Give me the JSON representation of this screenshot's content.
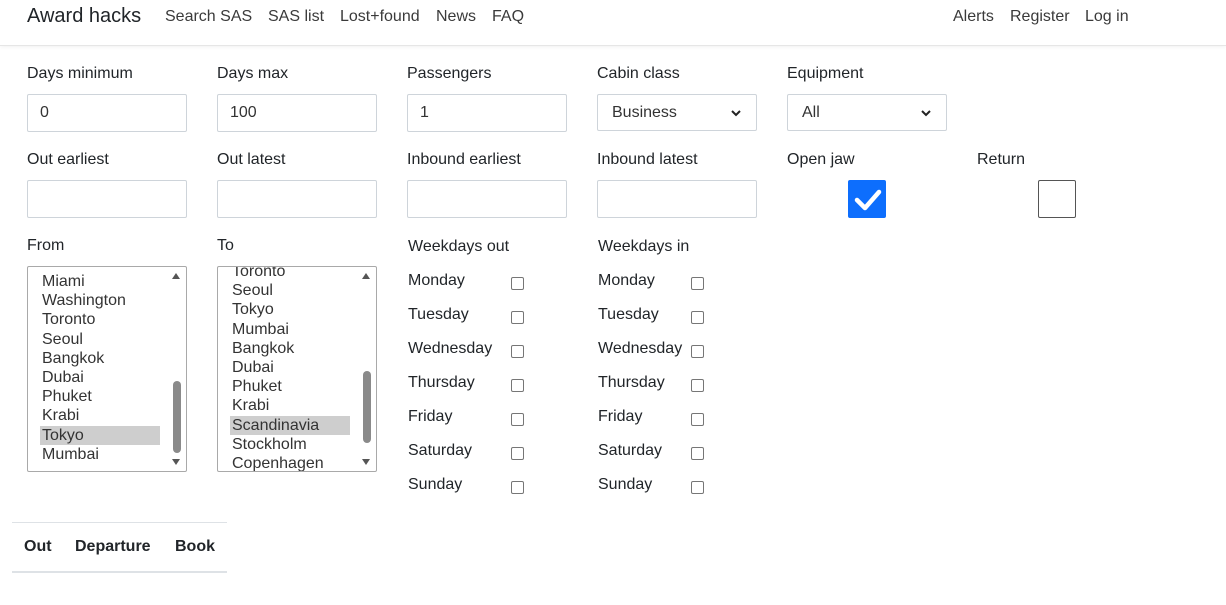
{
  "nav": {
    "brand": "Award hacks",
    "links": [
      "Search SAS",
      "SAS list",
      "Lost+found",
      "News",
      "FAQ"
    ],
    "right_links": [
      "Alerts",
      "Register",
      "Log in"
    ]
  },
  "form": {
    "days_min": {
      "label": "Days minimum",
      "value": "0"
    },
    "days_max": {
      "label": "Days max",
      "value": "100"
    },
    "passengers": {
      "label": "Passengers",
      "value": "1"
    },
    "cabin_class": {
      "label": "Cabin class",
      "selected": "Business"
    },
    "equipment": {
      "label": "Equipment",
      "selected": "All"
    },
    "out_earliest": {
      "label": "Out earliest",
      "value": ""
    },
    "out_latest": {
      "label": "Out latest",
      "value": ""
    },
    "inbound_earliest": {
      "label": "Inbound earliest",
      "value": ""
    },
    "inbound_latest": {
      "label": "Inbound latest",
      "value": ""
    },
    "open_jaw": {
      "label": "Open jaw",
      "checked": true
    },
    "return": {
      "label": "Return",
      "checked": false
    },
    "from": {
      "label": "From",
      "options": [
        "Miami",
        "Washington",
        "Toronto",
        "Seoul",
        "Bangkok",
        "Dubai",
        "Phuket",
        "Krabi",
        "Tokyo",
        "Mumbai"
      ],
      "selected": "Tokyo"
    },
    "to": {
      "label": "To",
      "options": [
        "Toronto",
        "Seoul",
        "Tokyo",
        "Mumbai",
        "Bangkok",
        "Dubai",
        "Phuket",
        "Krabi",
        "Scandinavia",
        "Stockholm",
        "Copenhagen"
      ],
      "selected": "Scandinavia"
    },
    "weekdays_out": {
      "label": "Weekdays out",
      "days": [
        "Monday",
        "Tuesday",
        "Wednesday",
        "Thursday",
        "Friday",
        "Saturday",
        "Sunday"
      ]
    },
    "weekdays_in": {
      "label": "Weekdays in",
      "days": [
        "Monday",
        "Tuesday",
        "Wednesday",
        "Thursday",
        "Friday",
        "Saturday",
        "Sunday"
      ]
    }
  },
  "results": {
    "headers": [
      "Out",
      "Departure",
      "Book"
    ]
  },
  "colors": {
    "accent": "#0d6efd",
    "selected_option": "#cecece"
  }
}
